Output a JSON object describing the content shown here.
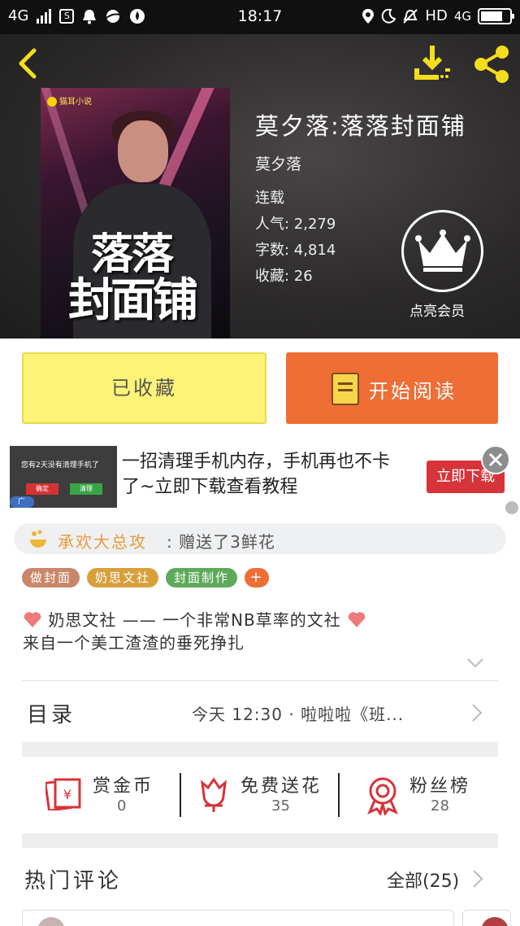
{
  "status_bar": {
    "network": "4G",
    "time": "18:17",
    "hd": "HD",
    "network2": "4G"
  },
  "header": {
    "cover_logo": "猫耳小说",
    "cover_title_line1": "落落",
    "cover_title_line2": "封面铺"
  },
  "book": {
    "title": "莫夕落:落落封面铺",
    "author": "莫夕落",
    "status": "连载",
    "popularity": "人气: 2,279",
    "word_count": "字数: 4,814",
    "favorites": "收藏: 26",
    "vip_label": "点亮会员"
  },
  "actions": {
    "collected_label": "已收藏",
    "read_label": "开始阅读"
  },
  "ad": {
    "image_question": "您有2天没有清理手机了",
    "image_btn_cancel": "确定",
    "image_btn_clean": "清理",
    "image_tag": "广告",
    "text": "一招清理手机内存，手机再也不卡了~立即下载查看教程",
    "cta": "立即下载"
  },
  "gift": {
    "user": "承欢大总攻",
    "message": ": 赠送了3鲜花"
  },
  "tags": [
    {
      "label": "做封面",
      "color": "#c8866a"
    },
    {
      "label": "奶思文社",
      "color": "#d8a03c"
    },
    {
      "label": "封面制作",
      "color": "#5eaa5a"
    },
    {
      "label": "+",
      "color": "#ee6e35"
    }
  ],
  "intro": {
    "line1": "奶思文社 ——  一个非常NB草率的文社",
    "line2": "来自一个美工渣渣的垂死挣扎"
  },
  "toc": {
    "label": "目录",
    "latest": "今天 12:30 · 啦啦啦《班..."
  },
  "stats": [
    {
      "label": "赏金币",
      "value": "0",
      "icon": "red-envelope-icon"
    },
    {
      "label": "免费送花",
      "value": "35",
      "icon": "flower-icon"
    },
    {
      "label": "粉丝榜",
      "value": "28",
      "icon": "medal-icon"
    }
  ],
  "comments": {
    "title": "热门评论",
    "all_label": "全部(25)"
  },
  "colors": {
    "accent_orange": "#ee6e35",
    "collected_yellow": "#fdf376",
    "icon_yellow": "#f2de1c",
    "icon_red": "#d6343a"
  }
}
